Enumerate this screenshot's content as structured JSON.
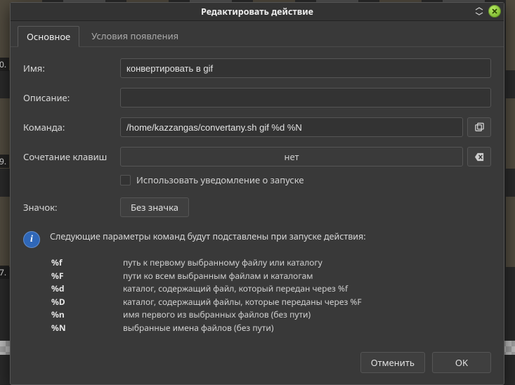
{
  "dialog_title": "Редактировать действие",
  "tabs": {
    "basic": "Основное",
    "conditions": "Условия появления"
  },
  "labels": {
    "name": "Имя:",
    "description": "Описание:",
    "command": "Команда:",
    "shortcut": "Сочетание клавиш",
    "startup_notify": "Использовать уведомление о запуске",
    "icon": "Значок:"
  },
  "values": {
    "name": "конвертировать в gif",
    "description": "",
    "command": "/home/kazzangas/convertany.sh gif %d %N",
    "shortcut": "нет",
    "icon_button": "Без значка"
  },
  "info_heading": "Следующие параметры команд будут подставлены при запуске действия:",
  "params": [
    {
      "k": "%f",
      "d": "путь к первому выбранному файлу или каталогу"
    },
    {
      "k": "%F",
      "d": "пути ко всем выбранным файлам и каталогам"
    },
    {
      "k": "%d",
      "d": "каталог, содержащий файл, который передан через %f"
    },
    {
      "k": "%D",
      "d": "каталог, содержащий файлы, которые переданы через %F"
    },
    {
      "k": "%n",
      "d": "имя первого из выбранных файлов (без пути)"
    },
    {
      "k": "%N",
      "d": "выбранные имена файлов (без пути)"
    }
  ],
  "buttons": {
    "cancel": "Отменить",
    "ok": "OK"
  },
  "bg": {
    "l1": "0.",
    "l2": "9.",
    "l3": "7."
  }
}
